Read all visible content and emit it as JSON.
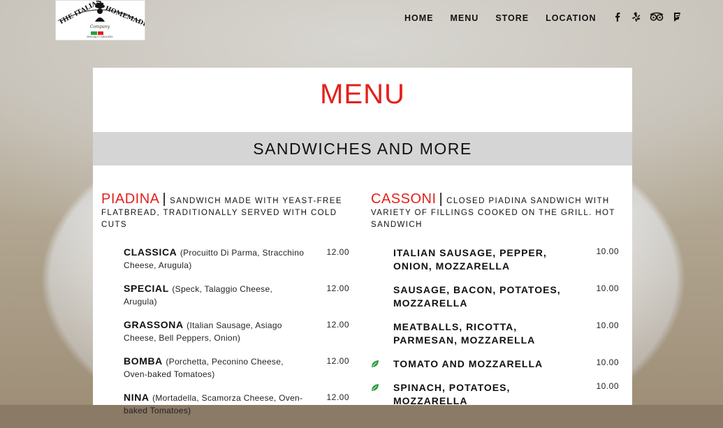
{
  "logo": {
    "title_words": [
      "THE ITALIAN",
      "HOMEMADE"
    ],
    "subtitle": "Company",
    "tagline": "SPECIALTY GROCERY"
  },
  "nav": {
    "items": [
      "HOME",
      "MENU",
      "STORE",
      "LOCATION"
    ]
  },
  "social": [
    "facebook-icon",
    "yelp-icon",
    "tripadvisor-icon",
    "foursquare-icon"
  ],
  "colors": {
    "accent": "#e3201b",
    "section_bar": "#d5d5d5",
    "leaf": "#2e9e3f"
  },
  "page": {
    "title": "MENU",
    "section": "SANDWICHES AND MORE"
  },
  "piadina": {
    "name": "PIADINA",
    "description": "SANDWICH MADE WITH YEAST-FREE FLATBREAD, TRADITIONALLY SERVED WITH COLD CUTS",
    "items": [
      {
        "name": "CLASSICA",
        "desc": "(Procuitto Di Parma, Stracchino Cheese, Arugula)",
        "price": "12.00"
      },
      {
        "name": "SPECIAL",
        "desc": "(Speck, Talaggio Cheese, Arugula)",
        "price": "12.00"
      },
      {
        "name": "GRASSONA",
        "desc": "(Italian Sausage, Asiago Cheese, Bell Peppers, Onion)",
        "price": "12.00"
      },
      {
        "name": "BOMBA",
        "desc": "(Porchetta, Peconino Cheese, Oven-baked Tomatoes)",
        "price": "12.00"
      },
      {
        "name": "NINA",
        "desc": "(Mortadella, Scamorza Cheese, Oven-baked Tomatoes)",
        "price": "12.00"
      }
    ]
  },
  "cassoni": {
    "name": "CASSONI",
    "description": "CLOSED PIADINA SANDWICH WITH VARIETY OF FILLINGS COOKED ON THE GRILL. HOT SANDWICH",
    "items": [
      {
        "name": "ITALIAN SAUSAGE, PEPPER, ONION, MOZZARELLA",
        "price": "10.00",
        "veg": false
      },
      {
        "name": "SAUSAGE, BACON, POTATOES, MOZZARELLA",
        "price": "10.00",
        "veg": false
      },
      {
        "name": "MEATBALLS, RICOTTA, PARMESAN, MOZZARELLA",
        "price": "10.00",
        "veg": false
      },
      {
        "name": "TOMATO AND MOZZARELLA",
        "price": "10.00",
        "veg": true
      },
      {
        "name": "SPINACH, POTATOES, MOZZARELLA",
        "price": "10.00",
        "veg": true
      }
    ]
  }
}
